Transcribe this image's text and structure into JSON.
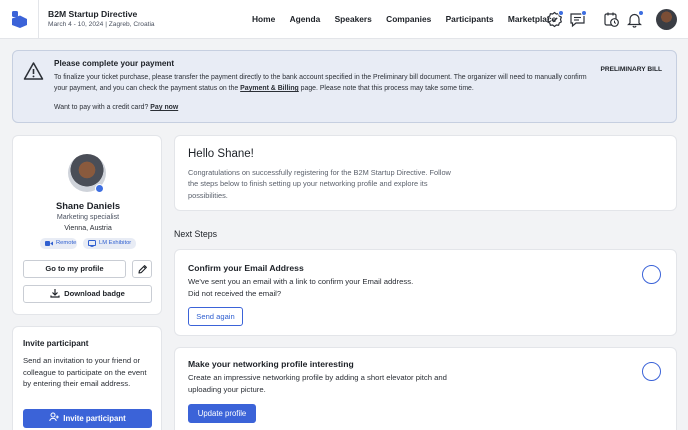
{
  "header": {
    "event_title": "B2M Startup Directive",
    "event_date": "March 4 - 10, 2024",
    "event_separator": "|",
    "event_location": "Zagreb, Croatia",
    "nav": [
      "Home",
      "Agenda",
      "Speakers",
      "Companies",
      "Participants",
      "Marketplace"
    ],
    "icons": [
      "badge-check-icon",
      "chat-icon",
      "calendar-clock-icon",
      "bell-icon"
    ],
    "accent_color": "#3b63d8"
  },
  "banner": {
    "title": "Please complete your payment",
    "text_before_link": "To finalize your ticket purchase, please transfer the payment directly to the bank account specified in the Preliminary bill document. The organizer will need to manually confirm your payment, and you can check the payment status on the ",
    "link": "Payment & Billing",
    "text_after_link": " page. Please note that this process may take some time.",
    "credit_prompt": "Want to pay with a credit card?",
    "pay_now": "Pay now",
    "preliminary_bill": "PRELIMINARY BILL"
  },
  "profile": {
    "name": "Shane Daniels",
    "role": "Marketing specialist",
    "location": "Vienna, Austria",
    "tags": [
      "Remote",
      "LM Exhibitor"
    ],
    "go_to_profile": "Go to my profile",
    "download_badge": "Download badge"
  },
  "invite": {
    "title": "Invite participant",
    "text": "Send an invitation to your friend or colleague to participate on the event by entering their email address.",
    "button": "Invite participant"
  },
  "welcome": {
    "title": "Hello Shane!",
    "text": "Congratulations on successfully registering for the B2M Startup Directive. Follow the steps below to finish setting up your networking profile and explore its possibilities."
  },
  "next_steps": {
    "heading": "Next Steps",
    "steps": [
      {
        "title": "Confirm your Email Address",
        "line1": "We've sent you an email with a link to confirm your Email address.",
        "line2": "Did not received the email?",
        "button": "Send again"
      },
      {
        "title": "Make your networking profile interesting",
        "line1": "Create an impressive networking profile by adding a short elevator pitch and uploading your picture.",
        "button": "Update profile"
      }
    ]
  }
}
